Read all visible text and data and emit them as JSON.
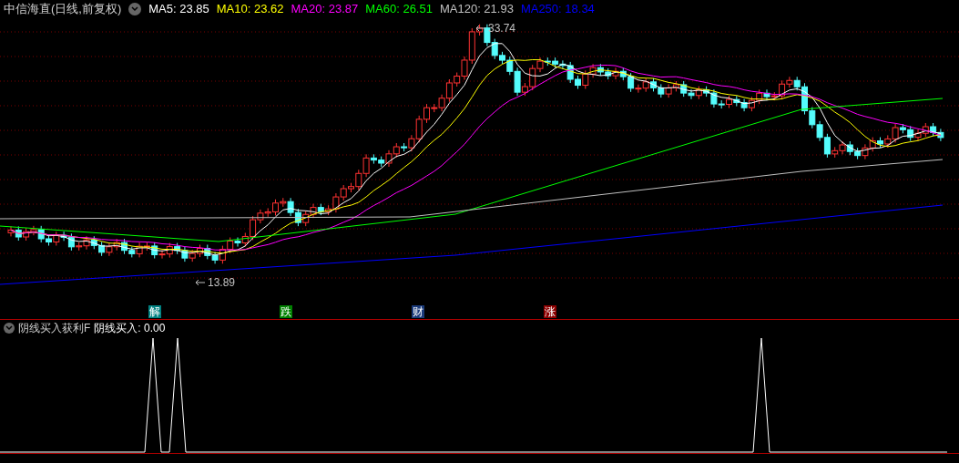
{
  "title": "中信海直(日线,前复权)",
  "ma": [
    {
      "label": "MA5: 23.85",
      "color": "#ffffff"
    },
    {
      "label": "MA10: 23.62",
      "color": "#ffff00"
    },
    {
      "label": "MA20: 23.87",
      "color": "#ff00ff"
    },
    {
      "label": "MA60: 26.51",
      "color": "#00ff00"
    },
    {
      "label": "MA120: 21.93",
      "color": "#c0c0c0"
    },
    {
      "label": "MA250: 18.34",
      "color": "#0000ff"
    }
  ],
  "chart": {
    "high_label": "33.74",
    "low_label": "13.89"
  },
  "markers": [
    {
      "text": "解",
      "color": "#008080"
    },
    {
      "text": "跌",
      "color": "#008000"
    },
    {
      "text": "财",
      "color": "#1a3a7a"
    },
    {
      "text": "涨",
      "color": "#8b0000"
    }
  ],
  "indicator": {
    "title": "阴线买入获利F",
    "reading": "阴线买入: 0.00"
  }
}
